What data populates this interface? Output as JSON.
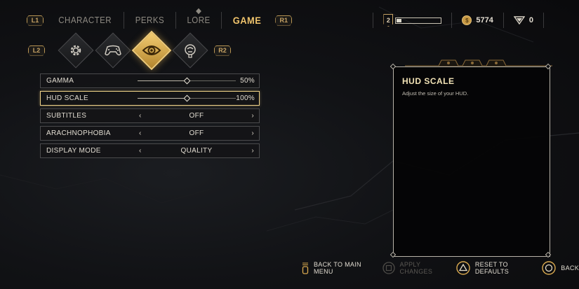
{
  "nav": {
    "left_shoulder": "L1",
    "right_shoulder": "R1",
    "tabs": [
      {
        "label": "CHARACTER",
        "active": false
      },
      {
        "label": "PERKS",
        "active": false
      },
      {
        "label": "LORE",
        "active": false
      },
      {
        "label": "GAME",
        "active": true
      }
    ]
  },
  "status": {
    "level": "2",
    "xp_progress": 0.14,
    "currency": "5774",
    "tokens": "0",
    "currency_icon": "coin-icon",
    "tokens_icon": "triangle-token-icon"
  },
  "categories": {
    "left_shoulder": "L2",
    "right_shoulder": "R2",
    "items": [
      {
        "icon": "gear-icon",
        "active": false
      },
      {
        "icon": "gamepad-icon",
        "active": false
      },
      {
        "icon": "eye-icon",
        "active": true
      },
      {
        "icon": "audio-head-icon",
        "active": false
      }
    ]
  },
  "settings": [
    {
      "label": "GAMMA",
      "type": "slider",
      "value": "50%",
      "level": 0.5
    },
    {
      "label": "HUD SCALE",
      "type": "slider",
      "value": "100%",
      "level": 0.5,
      "selected": true
    },
    {
      "label": "SUBTITLES",
      "type": "option",
      "value": "OFF"
    },
    {
      "label": "ARACHNOPHOBIA",
      "type": "option",
      "value": "OFF"
    },
    {
      "label": "DISPLAY MODE",
      "type": "option",
      "value": "QUALITY"
    }
  ],
  "panel": {
    "title": "HUD SCALE",
    "description": "Adjust the size of your HUD."
  },
  "prompts": [
    {
      "icon": "touchpad-icon",
      "label": "BACK TO MAIN MENU",
      "enabled": true
    },
    {
      "icon": "square-button-icon",
      "label": "APPLY CHANGES",
      "enabled": false
    },
    {
      "icon": "triangle-button-icon",
      "label": "RESET TO DEFAULTS",
      "enabled": true
    },
    {
      "icon": "circle-button-icon",
      "label": "BACK",
      "enabled": true
    }
  ],
  "colors": {
    "accent_gold": "#f0c46c",
    "panel_border": "#b8b3a8",
    "text": "#e0dbd0"
  }
}
